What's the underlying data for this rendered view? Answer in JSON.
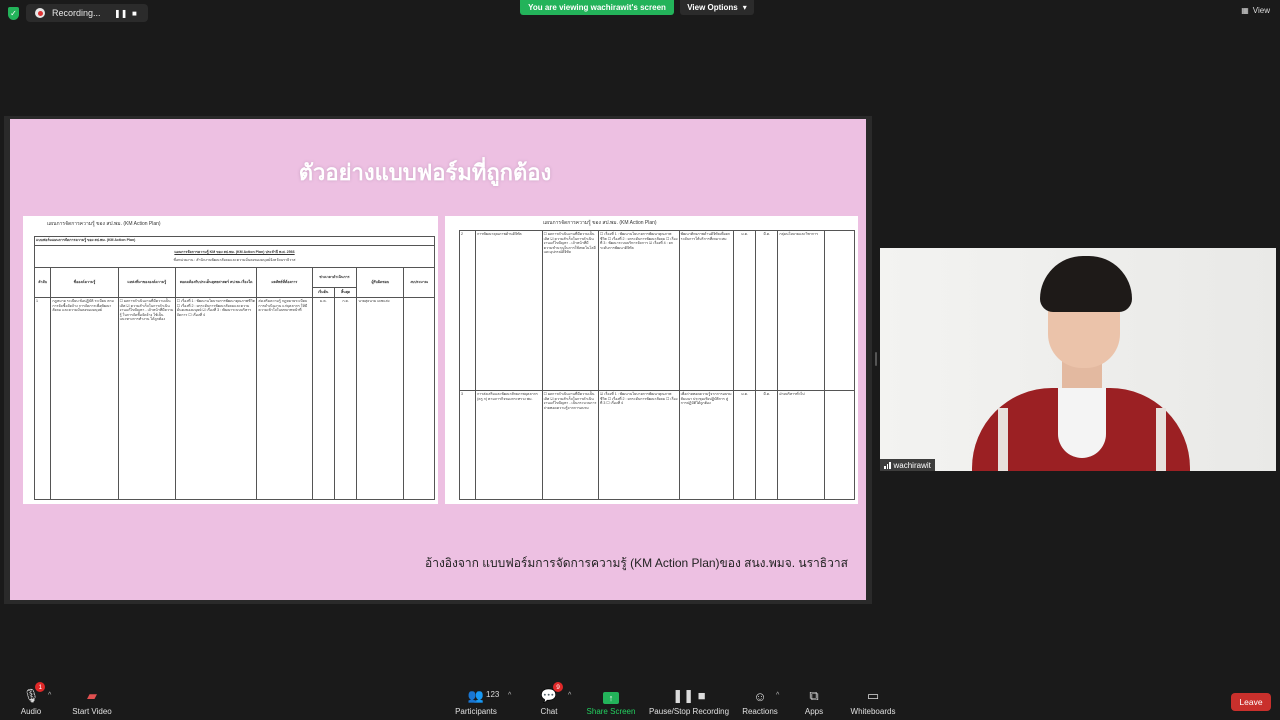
{
  "topbar": {
    "recording_label": "Recording...",
    "viewing_banner": "You are viewing wachirawit's screen",
    "view_options_label": "View Options",
    "view_label": "View"
  },
  "slide": {
    "title": "ตัวอย่างแบบฟอร์มที่ถูกต้อง",
    "caption": "อ้างอิงจาก แบบฟอร์มการจัดการความรู้ (KM Action Plan)ของ สนง.พมจ. นราธิวาส",
    "doc1": {
      "header": "แผนการจัดการความรู้ ของ สป.พม. (KM Action Plan)",
      "form_title": "แบบฟอร์มแผนการจัดการความรู้ ของ สป.พม. (KM Action Plan)",
      "plan_title": "แผนการจัดการความรู้ KM ของ สป.พม. (KM Action Plan) ประจำปี พ.ศ. 2566",
      "unit_line": "ชื่อหน่วยงาน : สำนักงานพัฒนาสังคมและความมั่นคงของมนุษย์จังหวัดนราธิวาส",
      "columns": [
        "ลำดับ",
        "ชื่อองค์ความรู้",
        "แหล่งที่มาขององค์ความรู้",
        "สอดคล้องกับประเด็นยุทธศาสตร์ สป.พม.เรื่องใด",
        "ผลลัพธ์ที่ต้องการ",
        "ช่วงเวลาดำเนินการ",
        "ผู้รับผิดชอบ",
        "งบประมาณ"
      ],
      "sub_columns": [
        "เริ่มต้น",
        "สิ้นสุด"
      ],
      "row": {
        "no": "1",
        "name": "กฎหมาย ระเบียบ ข้อปฏิบัติ ระเบียบ ตามการจัดซื้อจัดจ้าง การจัดการเพื่อพัฒนาสังคม และความมั่นคงของมนุษย์",
        "source": "☐ ผลการดำเนินงานที่มีความเป็นเลิศ ☑ ความสำเร็จในการดำเนินงานแก้ไขปัญหา - เจ้าหน้าที่มีความรู้ ในการจัดซื้อจัดจ้าง ใช้เป็นแนวทางการทำงาน ได้ถูกต้อง",
        "strategy": "☐ เรื่องที่ 1 : พัฒนานโยบายการพัฒนาคุณภาพชีวิต ☐ เรื่องที่ 2 : ยกระดับการพัฒนาสังคมและความมั่นคงของมนุษย์ ☑ เรื่องที่ 3 : พัฒนาระบบบริหารจัดการ ☐ เรื่องที่ 4",
        "result": "ส่งเสริมความรู้ กฎหมายระเบียบการดำเนินงาน แก่บุคลากร ให้มีความเข้าใจในบทบาทหน้าที่",
        "start": "ม.ค.",
        "end": "ก.ค.",
        "owner": "นายสุธนาม เดชแสง",
        "budget": ""
      }
    },
    "doc2": {
      "header": "แผนการจัดการความรู้ ของ สป.พม. (KM Action Plan)",
      "rows": [
        {
          "no": "2",
          "name": "การพัฒนาคุณภาพด้านดิจิทัล",
          "source": "☐ ผลการดำเนินงานที่มีความเป็นเลิศ ☑ ความสำเร็จในการดำเนินงานแก้ไขปัญหา - เจ้าหน้าที่มีความชำนาญในการใช้เทคโนโลยีและอุปกรณ์ดิจิทัล",
          "strategy": "☐ เรื่องที่ 1 : พัฒนานโยบายการพัฒนาคุณภาพชีวิต ☐ เรื่องที่ 2 : ยกระดับการพัฒนาสังคม ☐ เรื่องที่ 3 : พัฒนาระบบบริหารจัดการ ☑ เรื่องที่ 4 : ยกระดับการพัฒนาดิจิทัล",
          "result": "พัฒนาศักยภาพด้านดิจิทัลเพื่อยกระดับการให้บริการที่เหมาะสม",
          "start": "ม.ค.",
          "end": "มี.ค.",
          "owner": "กลุ่มนโยบายและวิชาการ",
          "budget": ""
        },
        {
          "no": "3",
          "name": "การส่งเสริมและพัฒนาศักยภาพบุคลากร (ครู ก) ตามภารกิจของกระทรวง พม.",
          "source": "☐ ผลการดำเนินงานที่มีความเป็นเลิศ ☑ ความสำเร็จในการดำเนินงานแก้ไขปัญหา - เป็นกระบวนการถ่ายทอดความรู้จากการอบรม",
          "strategy": "☑ เรื่องที่ 1 : พัฒนานโยบายการพัฒนาคุณภาพชีวิต ☐ เรื่องที่ 2 : ยกระดับการพัฒนาสังคม ☐ เรื่องที่ 3 ☐ เรื่องที่ 4",
          "result": "เพื่อถ่ายทอดความรู้จากการอบรม สัมมนา ประชุมเชิงปฏิบัติการ สู่การปฏิบัติได้ถูกต้อง",
          "start": "ม.ค.",
          "end": "มี.ค.",
          "owner": "ฝ่ายบริหารทั่วไป",
          "budget": ""
        }
      ]
    }
  },
  "video": {
    "participant_name": "wachirawit"
  },
  "toolbar": {
    "audio": "Audio",
    "audio_badge": "1",
    "start_video": "Start Video",
    "participants": "Participants",
    "participants_count": "123",
    "chat": "Chat",
    "chat_badge": "9",
    "share_screen": "Share Screen",
    "pause_stop_recording": "Pause/Stop Recording",
    "reactions": "Reactions",
    "apps": "Apps",
    "whiteboards": "Whiteboards",
    "leave": "Leave"
  },
  "colors": {
    "accent_green": "#23b35a",
    "slide_background": "#edc0e2",
    "leave_red": "#c9302c",
    "badge_red": "#e02828"
  }
}
